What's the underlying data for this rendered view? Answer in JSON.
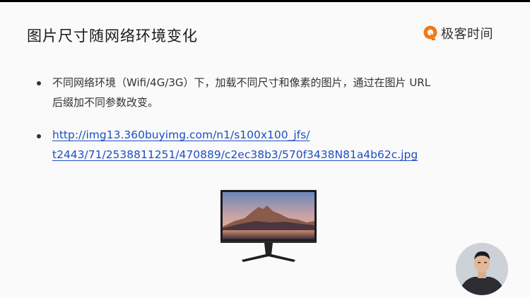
{
  "slide": {
    "title": "图片尺寸随网络环境变化",
    "logo_text": "极客时间",
    "bullets": {
      "first_line1": "不同网络环境（Wifi/4G/3G）下，加载不同尺寸和像素的图片，通过在图片 URL",
      "first_line2": "后缀加不同参数改变。",
      "link_line1": "http://img13.360buyimg.com/n1/s100x100_jfs/",
      "link_line2": "t2443/71/2538811251/470889/c2ec38b3/570f3438N81a4b62c.jpg"
    }
  },
  "icons": {
    "logo": "geek-time-logo-icon",
    "monitor": "monitor-image",
    "presenter": "presenter-avatar"
  },
  "colors": {
    "link": "#1d4fc4",
    "logo_accent": "#f07a1a",
    "slide_bg": "#fafafa"
  }
}
